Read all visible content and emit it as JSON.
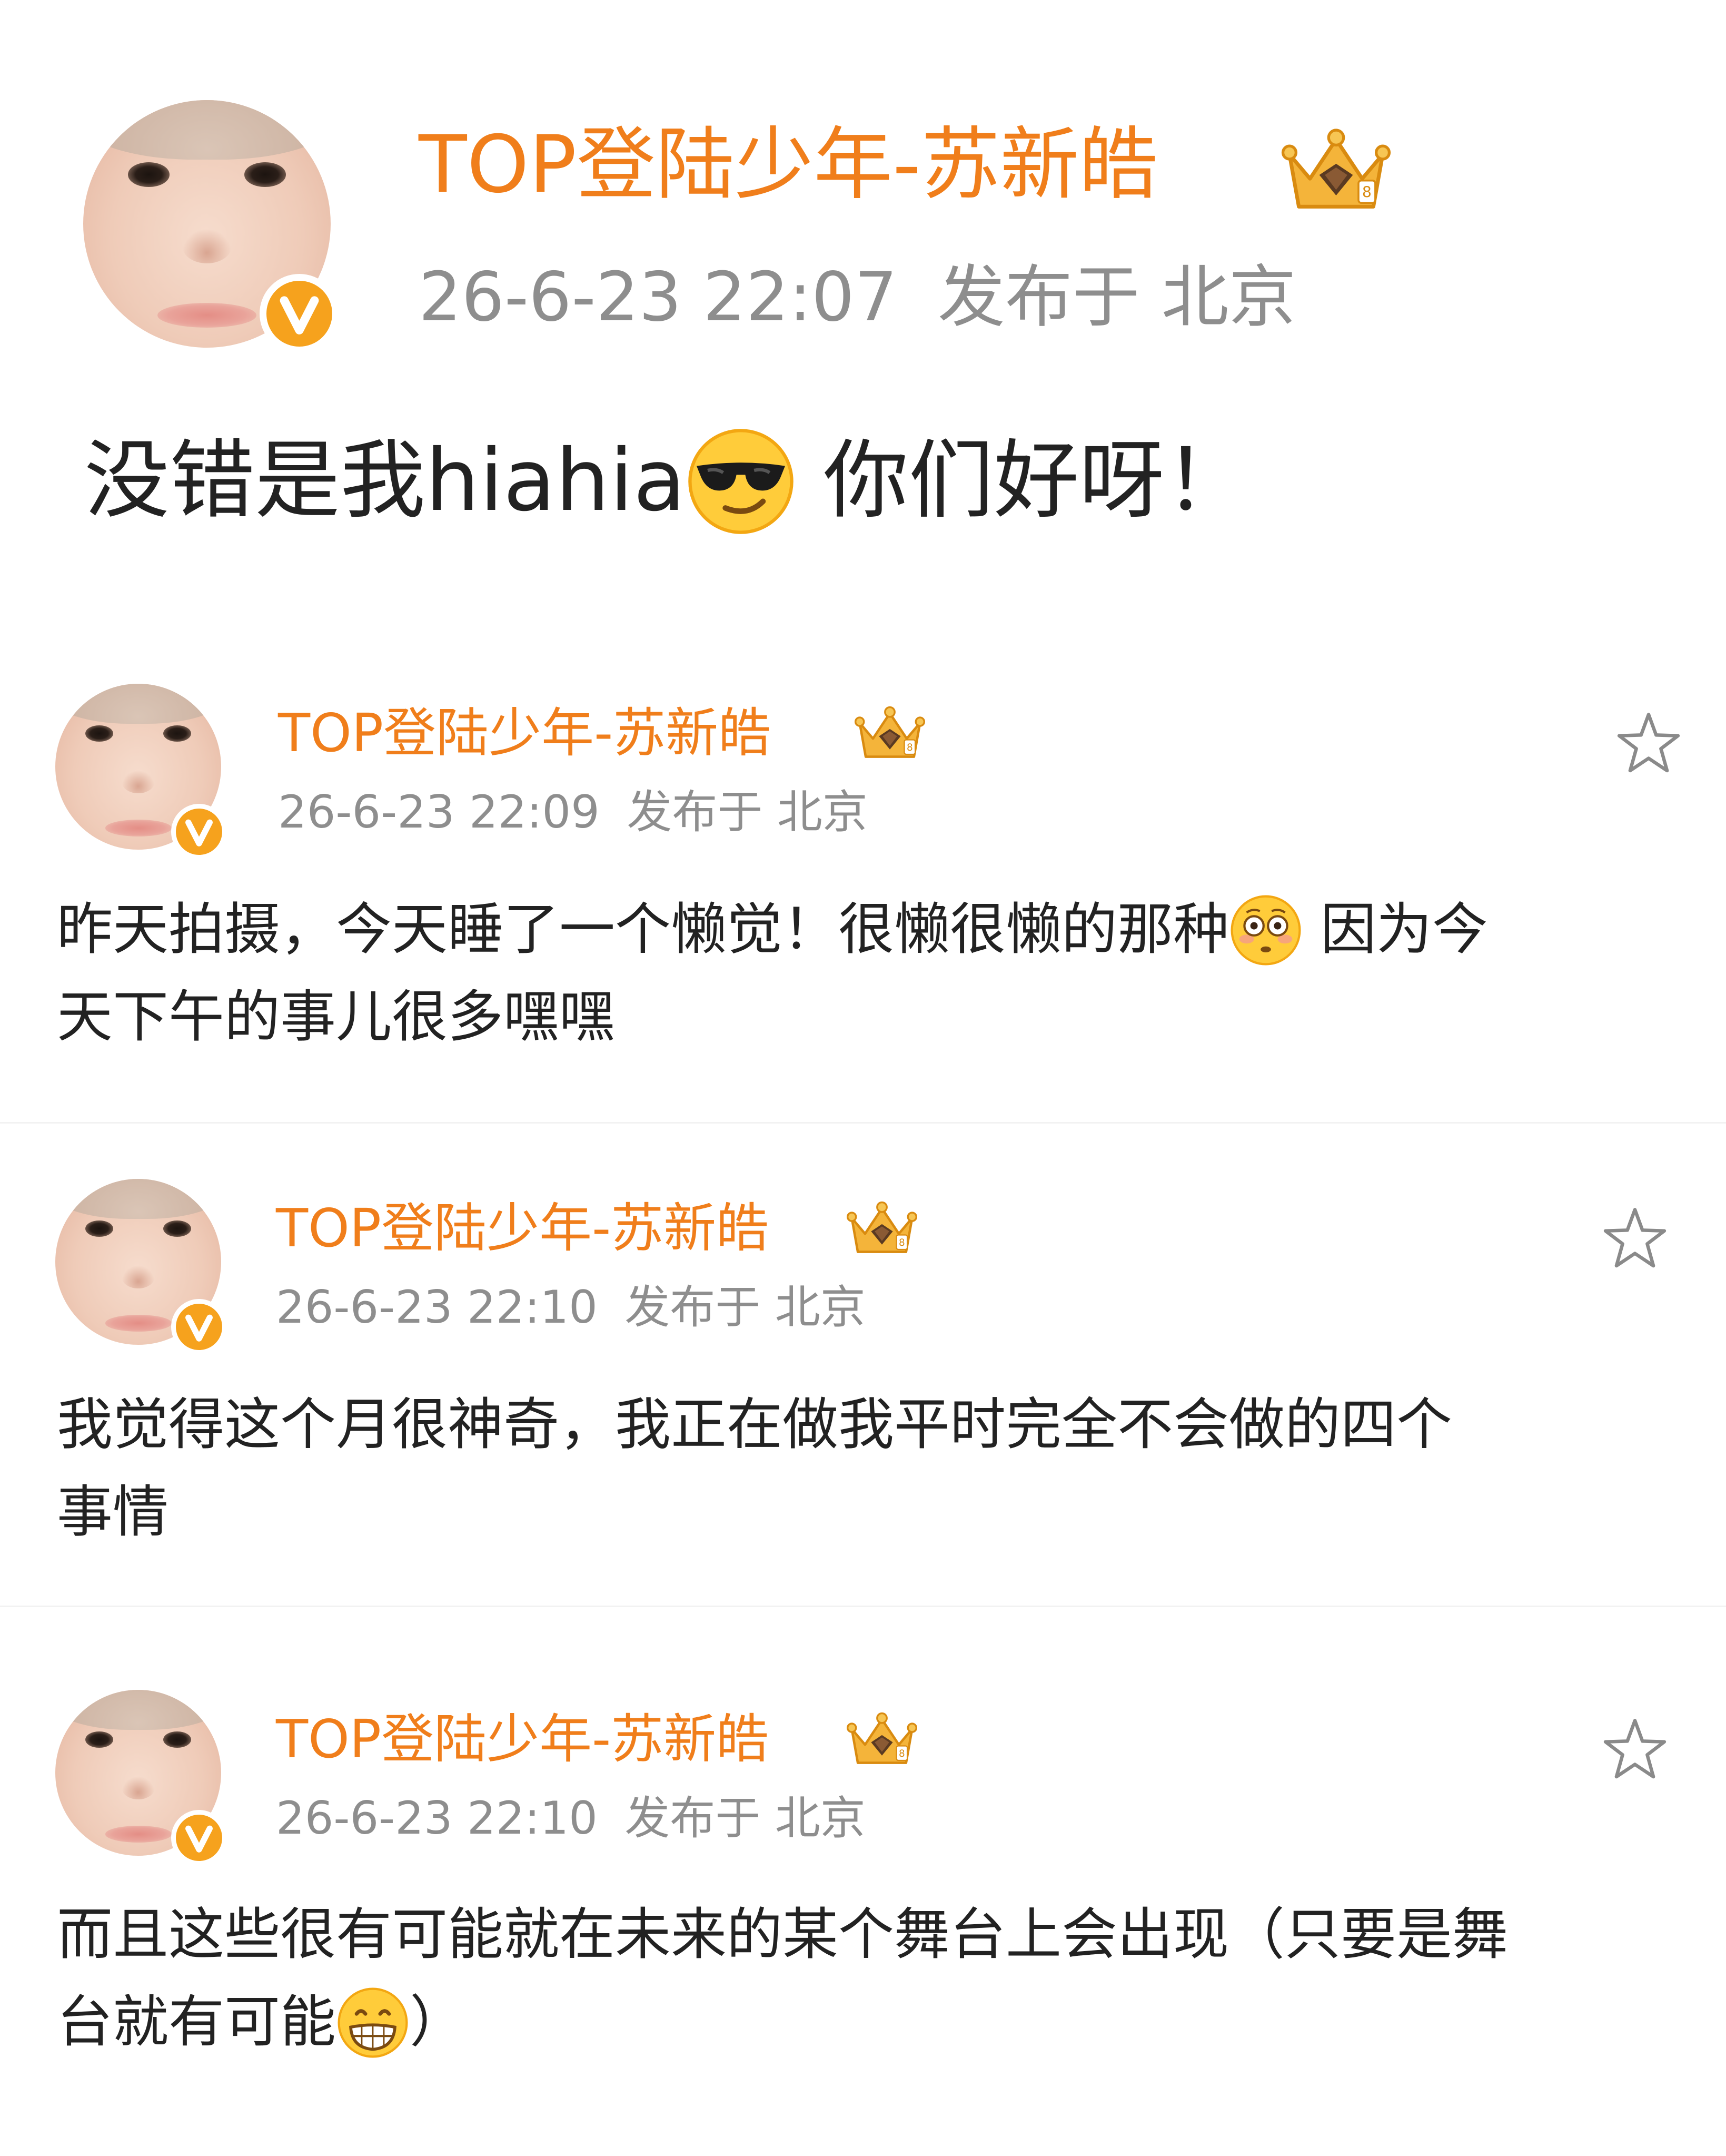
{
  "posts": [
    {
      "author": "TOP登陆少年-苏新皓",
      "time": "26-6-23 22:07",
      "location": "发布于 北京",
      "text_a": "没错是我hiahia",
      "text_b": " 你们好呀！",
      "emoji": "sunglasses-emoji"
    },
    {
      "author": "TOP登陆少年-苏新皓",
      "time": "26-6-23 22:09",
      "location": "发布于 北京",
      "line1_a": "昨天拍摄，今天睡了一个懒觉！很懒很懒的那种",
      "line1_b": " 因为今",
      "line2": "天下午的事儿很多嘿嘿",
      "emoji": "flushed-emoji"
    },
    {
      "author": "TOP登陆少年-苏新皓",
      "time": "26-6-23 22:10",
      "location": "发布于 北京",
      "line1": "我觉得这个月很神奇，我正在做我平时完全不会做的四个",
      "line2": "事情"
    },
    {
      "author": "TOP登陆少年-苏新皓",
      "time": "26-6-23 22:10",
      "location": "发布于 北京",
      "line1": "而且这些很有可能就在未来的某个舞台上会出现（只要是舞",
      "line2_a": "台就有可能",
      "line2_b": "）",
      "emoji": "grinning-emoji"
    }
  ],
  "colors": {
    "username": "#f07e1b",
    "meta": "#8e8e8e",
    "body_text": "#222222",
    "verified_badge": "#f6a21d"
  },
  "icons": {
    "verified": "verified-v-badge-icon",
    "crown": "crown-member-icon",
    "favorite": "star-outline-icon"
  }
}
